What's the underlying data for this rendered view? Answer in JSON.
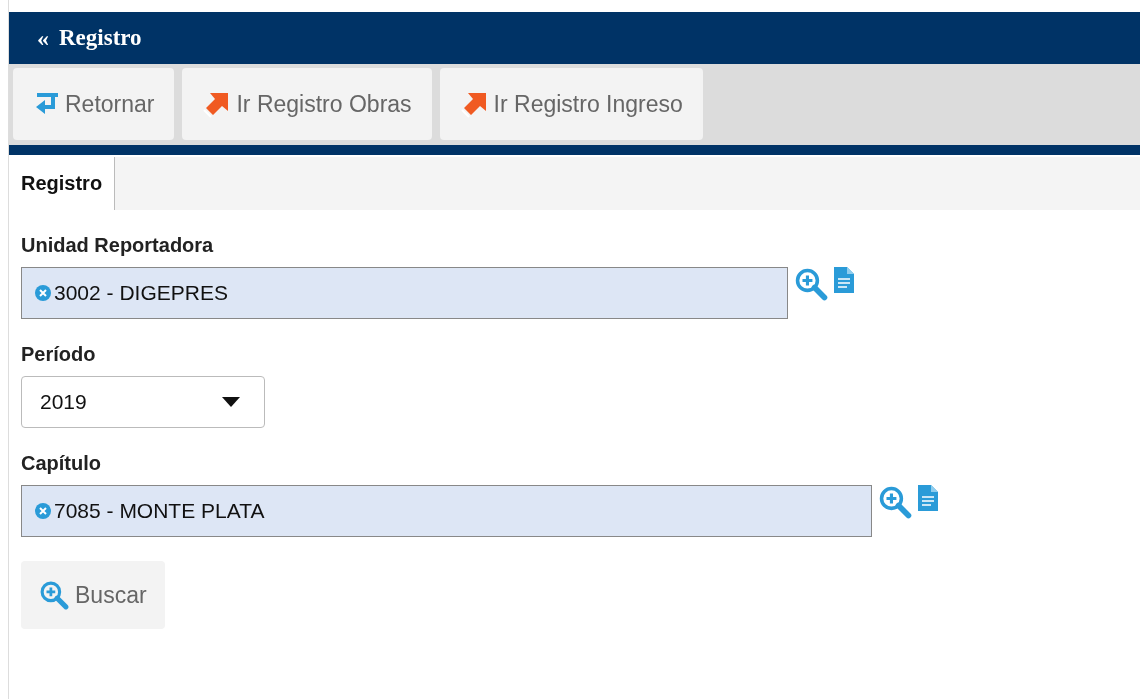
{
  "header": {
    "collapse": "«",
    "title": "Registro"
  },
  "toolbar": [
    {
      "label": "Retornar",
      "kind": "return"
    },
    {
      "label": "Ir Registro Obras",
      "kind": "goto"
    },
    {
      "label": "Ir Registro Ingreso",
      "kind": "goto"
    }
  ],
  "tabs": [
    {
      "label": "Registro",
      "selected": true
    }
  ],
  "fields": [
    {
      "label": "Unidad Reportadora",
      "kind": "multiselect",
      "chips": [
        "3002 - DIGEPRES"
      ],
      "wide": false
    },
    {
      "label": "Período",
      "kind": "select",
      "value": "2019"
    },
    {
      "label": "Capítulo",
      "kind": "multiselect",
      "chips": [
        "7085 - MONTE PLATA"
      ],
      "wide": true
    }
  ],
  "search_button": {
    "label": "Buscar"
  }
}
